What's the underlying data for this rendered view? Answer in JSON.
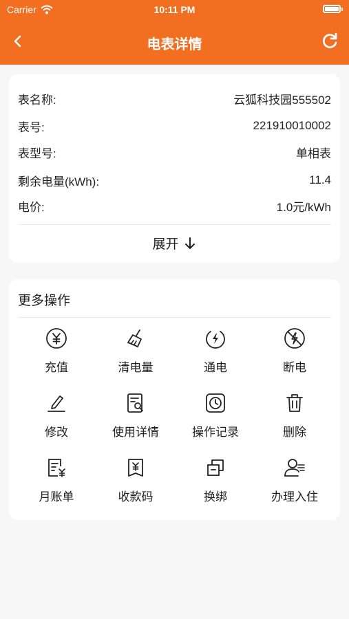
{
  "status": {
    "carrier": "Carrier",
    "time": "10:11 PM"
  },
  "nav": {
    "title": "电表详情"
  },
  "info": {
    "rows": [
      {
        "label": "表名称:",
        "value": "云狐科技园555502"
      },
      {
        "label": "表号:",
        "value": "221910010002"
      },
      {
        "label": "表型号:",
        "value": "单相表"
      },
      {
        "label": "剩余电量(kWh):",
        "value": "11.4"
      },
      {
        "label": "电价:",
        "value": "1.0元/kWh"
      }
    ],
    "expand_label": "展开"
  },
  "ops": {
    "title": "更多操作",
    "items": [
      {
        "label": "充值",
        "icon": "yen-circle-icon"
      },
      {
        "label": "清电量",
        "icon": "broom-icon"
      },
      {
        "label": "通电",
        "icon": "power-on-icon"
      },
      {
        "label": "断电",
        "icon": "power-off-icon"
      },
      {
        "label": "修改",
        "icon": "edit-icon"
      },
      {
        "label": "使用详情",
        "icon": "usage-detail-icon"
      },
      {
        "label": "操作记录",
        "icon": "history-icon"
      },
      {
        "label": "删除",
        "icon": "trash-icon"
      },
      {
        "label": "月账单",
        "icon": "bill-icon"
      },
      {
        "label": "收款码",
        "icon": "payment-code-icon"
      },
      {
        "label": "换绑",
        "icon": "rebind-icon"
      },
      {
        "label": "办理入住",
        "icon": "check-in-icon"
      }
    ]
  },
  "colors": {
    "brand": "#f26f22",
    "background": "#f7f7f7",
    "card": "#ffffff"
  }
}
